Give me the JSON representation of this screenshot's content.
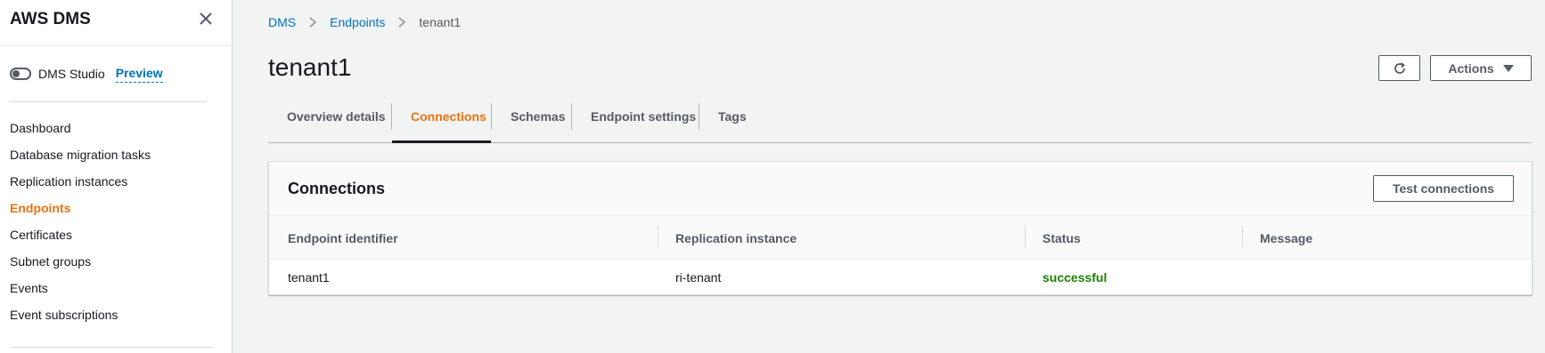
{
  "sidebar": {
    "title": "AWS DMS",
    "studio_label": "DMS Studio",
    "preview_label": "Preview",
    "items": [
      {
        "label": "Dashboard"
      },
      {
        "label": "Database migration tasks"
      },
      {
        "label": "Replication instances"
      },
      {
        "label": "Endpoints"
      },
      {
        "label": "Certificates"
      },
      {
        "label": "Subnet groups"
      },
      {
        "label": "Events"
      },
      {
        "label": "Event subscriptions"
      }
    ],
    "active_item": "Endpoints"
  },
  "breadcrumb": [
    "DMS",
    "Endpoints",
    "tenant1"
  ],
  "page": {
    "title": "tenant1",
    "actions_label": "Actions"
  },
  "tabs": [
    {
      "label": "Overview details"
    },
    {
      "label": "Connections"
    },
    {
      "label": "Schemas"
    },
    {
      "label": "Endpoint settings"
    },
    {
      "label": "Tags"
    }
  ],
  "active_tab": "Connections",
  "connections": {
    "title": "Connections",
    "test_button": "Test connections",
    "columns": [
      "Endpoint identifier",
      "Replication instance",
      "Status",
      "Message"
    ],
    "rows": [
      {
        "endpoint": "tenant1",
        "instance": "ri-tenant",
        "status": "successful",
        "message": ""
      }
    ]
  },
  "colors": {
    "link": "#0073bb",
    "accent_orange": "#ec7211",
    "success_green": "#1d8102",
    "background": "#f2f3f3"
  },
  "icons": {
    "close": "close-icon",
    "refresh": "refresh-icon",
    "breadcrumb_separator": "chevron-right-icon",
    "actions_caret": "caret-down-icon"
  }
}
